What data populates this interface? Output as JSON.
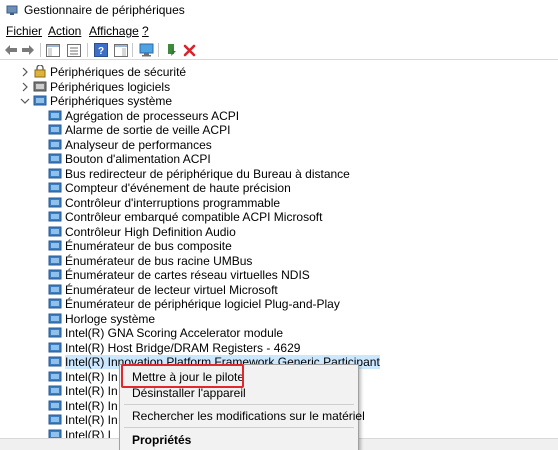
{
  "window": {
    "title": "Gestionnaire de périphériques"
  },
  "menu": {
    "items": [
      {
        "label": "Fichier"
      },
      {
        "label": "Action"
      },
      {
        "label": "Affichage"
      },
      {
        "label": "?"
      }
    ]
  },
  "toolbar": {
    "buttons": [
      "back-arrow-icon",
      "forward-arrow-icon",
      "console-tree-icon",
      "properties-icon",
      "help-icon",
      "action-pane-icon",
      "monitor-icon",
      "update-driver-icon",
      "uninstall-icon"
    ]
  },
  "tree": {
    "categories": [
      {
        "label": "Périphériques de sécurité",
        "expanded": false
      },
      {
        "label": "Périphériques logiciels",
        "expanded": false
      },
      {
        "label": "Périphériques système",
        "expanded": true
      }
    ],
    "devices": [
      "Agrégation de processeurs ACPI",
      "Alarme de sortie de veille ACPI",
      "Analyseur de performances",
      "Bouton d'alimentation ACPI",
      "Bus redirecteur de périphérique du Bureau à distance",
      "Compteur d'événement de haute précision",
      "Contrôleur d'interruptions programmable",
      "Contrôleur embarqué compatible ACPI Microsoft",
      "Contrôleur High Definition Audio",
      "Énumérateur de bus composite",
      "Énumérateur de bus racine UMBus",
      "Énumérateur de cartes réseau virtuelles NDIS",
      "Énumérateur de lecteur virtuel Microsoft",
      "Énumérateur de périphérique logiciel Plug-and-Play",
      "Horloge système",
      "Intel(R) GNA Scoring Accelerator module",
      "Intel(R) Host Bridge/DRAM Registers - 4629",
      "Intel(R) Innovation Platform Framework Generic Participant",
      "Intel(R) In",
      "Intel(R) In",
      "Intel(R) In",
      "Intel(R) In",
      "Intel(R) I"
    ]
  },
  "context_menu": {
    "items": [
      {
        "label": "Mettre à jour le pilote",
        "bold": false
      },
      {
        "label": "Désinstaller l'appareil",
        "bold": false
      },
      {
        "label": "Rechercher les modifications sur le matériel",
        "bold": false
      },
      {
        "label": "Propriétés",
        "bold": true
      }
    ]
  },
  "colors": {
    "selection": "#cce8ff",
    "highlight_box": "#e0282e",
    "device_icon": "#3a7fc4"
  }
}
